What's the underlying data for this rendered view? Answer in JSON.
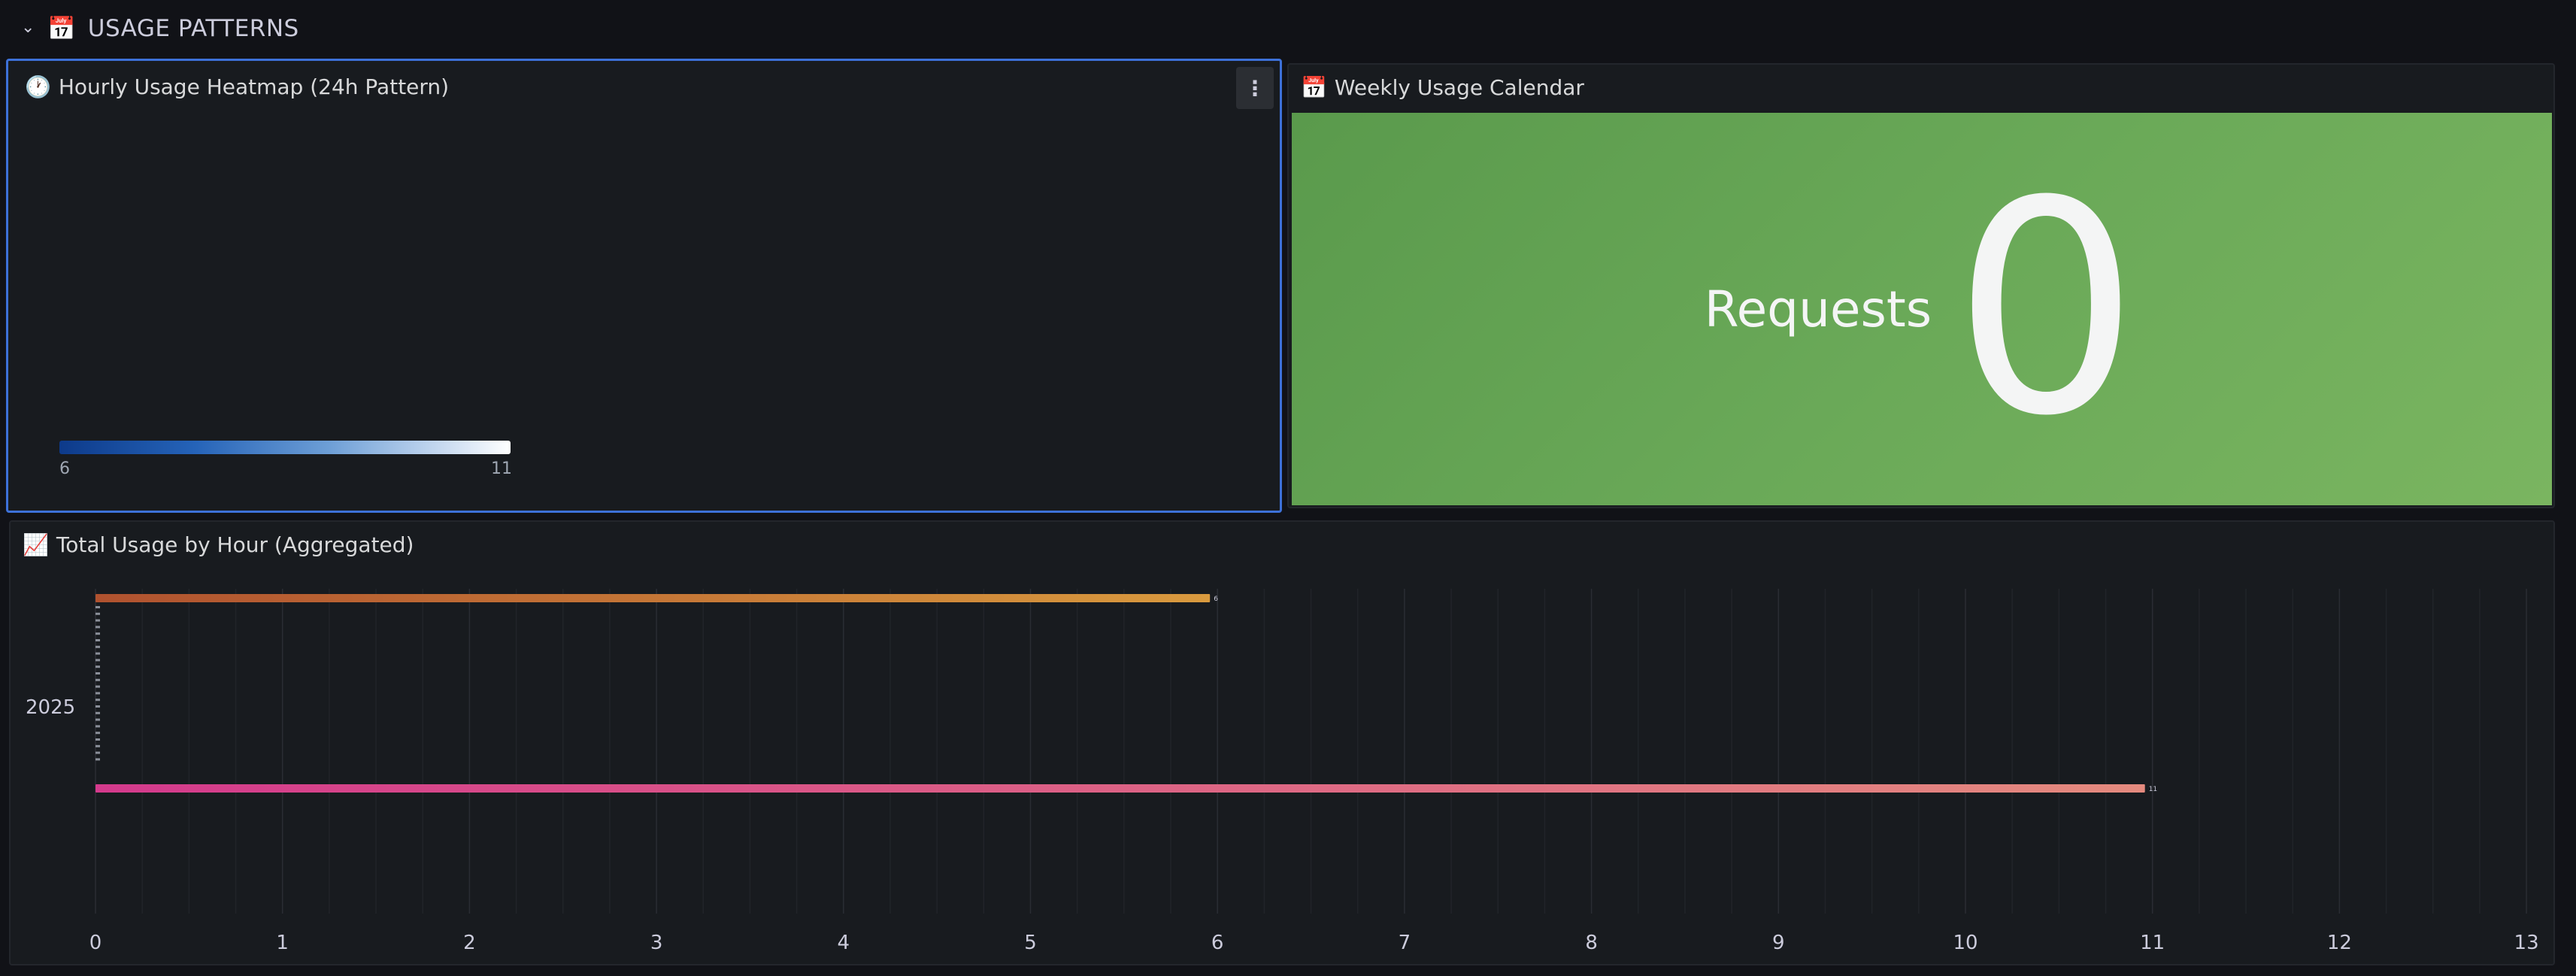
{
  "row": {
    "chevron": "⌄",
    "icon": "📅",
    "title": "USAGE PATTERNS"
  },
  "heatmap_panel": {
    "icon": "🕐",
    "title": "Hourly Usage Heatmap (24h Pattern)",
    "menu": "⋮",
    "legend_min": "6",
    "legend_max": "11",
    "colors": {
      "low": "#0d3a8a",
      "high": "#ffffff"
    }
  },
  "calendar_panel": {
    "icon": "📅",
    "title": "Weekly Usage Calendar",
    "stat_label": "Requests",
    "stat_value": "0",
    "color": "#6aa958"
  },
  "total_panel": {
    "icon": "📈",
    "title": "Total Usage by Hour (Aggregated)"
  },
  "chart_data": {
    "type": "bar",
    "orientation": "horizontal",
    "categories": [
      "2025"
    ],
    "series": [
      {
        "values": [
          6
        ],
        "color_start": "#b0522f",
        "color_end": "#d99a3e",
        "label": "6"
      },
      {
        "values": [
          11
        ],
        "color_start": "#d43a8c",
        "color_end": "#e48a7e",
        "label": "11"
      }
    ],
    "x_ticks": [
      "0",
      "1",
      "2",
      "3",
      "4",
      "5",
      "6",
      "7",
      "8",
      "9",
      "10",
      "11",
      "12",
      "13"
    ],
    "xlim": [
      0,
      13
    ],
    "grid": true
  }
}
